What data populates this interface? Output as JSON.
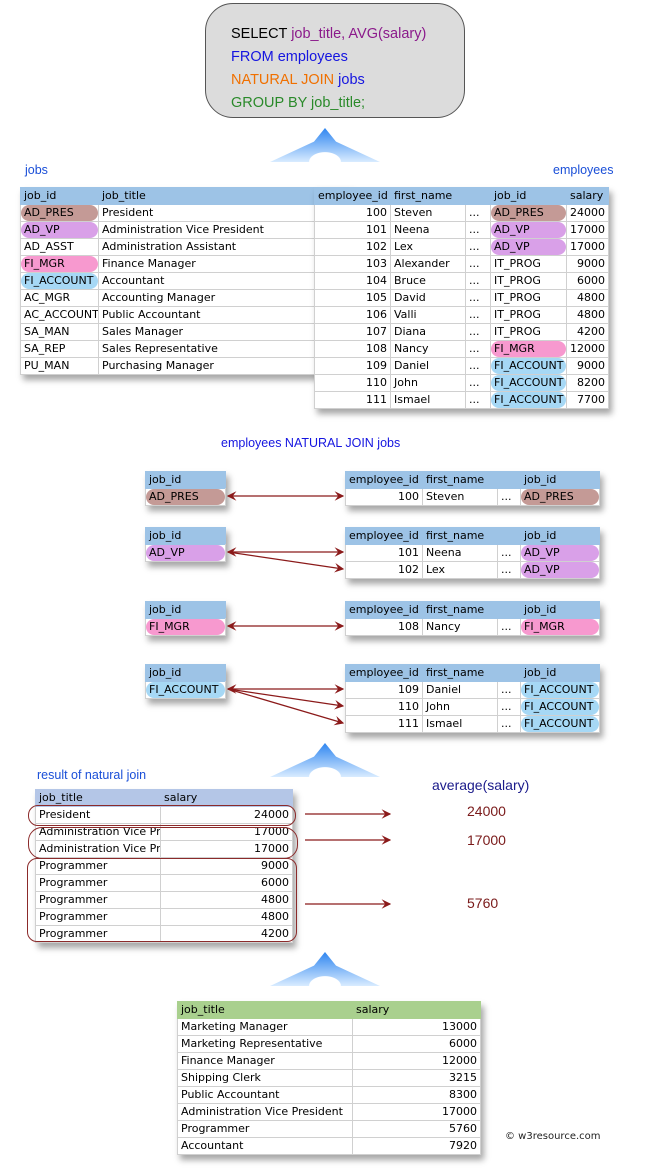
{
  "sql": {
    "l1a": "SELECT ",
    "l1b": "job_title, AVG(salary)",
    "l2": "FROM employees",
    "l3a": "NATURAL JOIN ",
    "l3b": "jobs",
    "l4": "GROUP BY job_title;"
  },
  "labels": {
    "jobs": "jobs",
    "employees": "employees",
    "join": "employees NATURAL JOIN jobs",
    "result": "result of natural join",
    "average": "average(salary)",
    "plus": "+",
    "copyright": "© w3resource.com"
  },
  "colors": {
    "AD_PRES": "#c49a96",
    "AD_VP": "#d9a0e8",
    "FI_MGR": "#f799cf",
    "FI_ACCOUNT": "#a6d8f5",
    "arrow": "#8b1a1a"
  },
  "jobs": {
    "headers": [
      "job_id",
      "job_title"
    ],
    "rows": [
      [
        "AD_PRES",
        "President"
      ],
      [
        "AD_VP",
        "Administration Vice President"
      ],
      [
        "AD_ASST",
        "Administration Assistant"
      ],
      [
        "FI_MGR",
        "Finance Manager"
      ],
      [
        "FI_ACCOUNT",
        "Accountant"
      ],
      [
        "AC_MGR",
        "Accounting Manager"
      ],
      [
        "AC_ACCOUNT",
        "Public Accountant"
      ],
      [
        "SA_MAN",
        "Sales Manager"
      ],
      [
        "SA_REP",
        "Sales Representative"
      ],
      [
        "PU_MAN",
        "Purchasing Manager"
      ]
    ]
  },
  "employees": {
    "headers": [
      "employee_id",
      "first_name",
      "",
      "job_id",
      "salary"
    ],
    "rows": [
      [
        "100",
        "Steven",
        "...",
        "AD_PRES",
        "24000"
      ],
      [
        "101",
        "Neena",
        "...",
        "AD_VP",
        "17000"
      ],
      [
        "102",
        "Lex",
        "...",
        "AD_VP",
        "17000"
      ],
      [
        "103",
        "Alexander",
        "...",
        "IT_PROG",
        "9000"
      ],
      [
        "104",
        "Bruce",
        "...",
        "IT_PROG",
        "6000"
      ],
      [
        "105",
        "David",
        "...",
        "IT_PROG",
        "4800"
      ],
      [
        "106",
        "Valli",
        "...",
        "IT_PROG",
        "4800"
      ],
      [
        "107",
        "Diana",
        "...",
        "IT_PROG",
        "4200"
      ],
      [
        "108",
        "Nancy",
        "...",
        "FI_MGR",
        "12000"
      ],
      [
        "109",
        "Daniel",
        "...",
        "FI_ACCOUNT",
        "9000"
      ],
      [
        "110",
        "John",
        "...",
        "FI_ACCOUNT",
        "8200"
      ],
      [
        "111",
        "Ismael",
        "...",
        "FI_ACCOUNT",
        "7700"
      ]
    ]
  },
  "join_groups": [
    {
      "job_id": "AD_PRES",
      "rows": [
        [
          "100",
          "Steven",
          "...",
          "AD_PRES"
        ]
      ]
    },
    {
      "job_id": "AD_VP",
      "rows": [
        [
          "101",
          "Neena",
          "...",
          "AD_VP"
        ],
        [
          "102",
          "Lex",
          "...",
          "AD_VP"
        ]
      ]
    },
    {
      "job_id": "FI_MGR",
      "rows": [
        [
          "108",
          "Nancy",
          "...",
          "FI_MGR"
        ]
      ]
    },
    {
      "job_id": "FI_ACCOUNT",
      "rows": [
        [
          "109",
          "Daniel",
          "...",
          "FI_ACCOUNT"
        ],
        [
          "110",
          "John",
          "...",
          "FI_ACCOUNT"
        ],
        [
          "111",
          "Ismael",
          "...",
          "FI_ACCOUNT"
        ]
      ]
    }
  ],
  "join_headers": {
    "left": [
      "job_id"
    ],
    "right": [
      "employee_id",
      "first_name",
      "",
      "job_id"
    ]
  },
  "result": {
    "headers": [
      "job_title",
      "salary"
    ],
    "rows": [
      [
        "President",
        "24000"
      ],
      [
        "Administration Vice Pr",
        "17000"
      ],
      [
        "Administration Vice Pr",
        "17000"
      ],
      [
        "Programmer",
        "9000"
      ],
      [
        "Programmer",
        "6000"
      ],
      [
        "Programmer",
        "4800"
      ],
      [
        "Programmer",
        "4800"
      ],
      [
        "Programmer",
        "4200"
      ]
    ]
  },
  "averages": [
    "24000",
    "17000",
    "5760"
  ],
  "final": {
    "headers": [
      "job_title",
      "salary"
    ],
    "rows": [
      [
        "Marketing Manager",
        "13000"
      ],
      [
        "Marketing Representative",
        "6000"
      ],
      [
        "Finance Manager",
        "12000"
      ],
      [
        "Shipping Clerk",
        "3215"
      ],
      [
        "Public Accountant",
        "8300"
      ],
      [
        "Administration Vice President",
        "17000"
      ],
      [
        "Programmer",
        "5760"
      ],
      [
        "Accountant",
        "7920"
      ]
    ]
  }
}
